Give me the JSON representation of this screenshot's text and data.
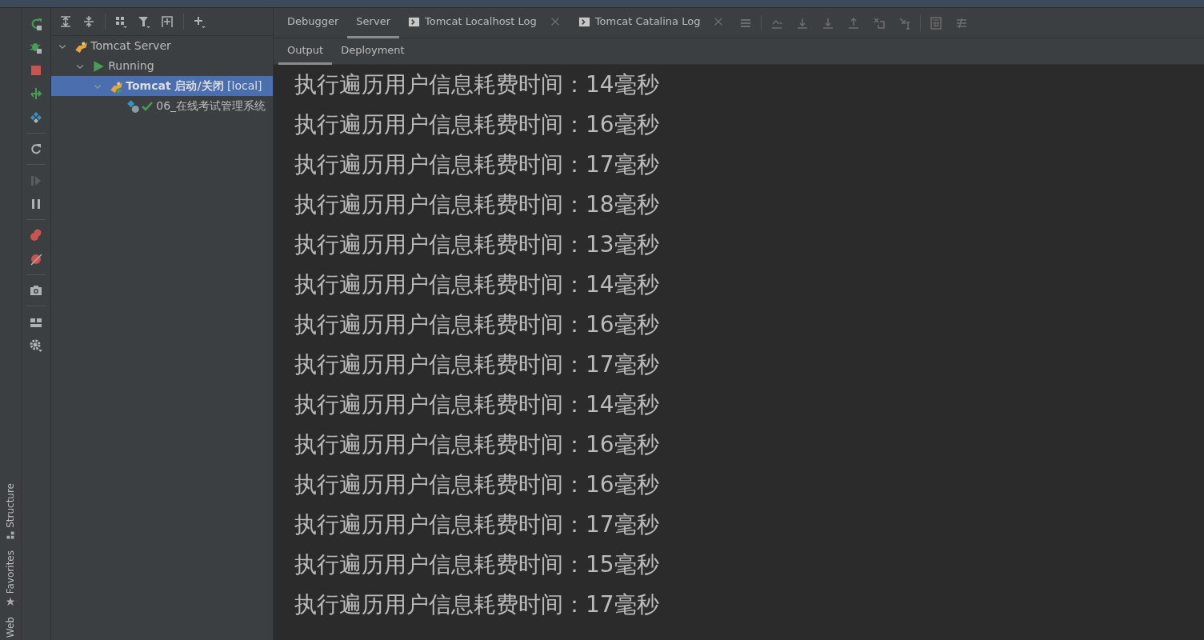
{
  "side_tool_windows": [
    {
      "label": "Structure",
      "kind": "structure"
    },
    {
      "label": "Favorites",
      "kind": "favorites"
    },
    {
      "label": "Web",
      "kind": "web"
    }
  ],
  "tree": [
    {
      "label": "Tomcat Server",
      "kind": "server",
      "expanded": true,
      "selected": false,
      "children": [
        {
          "label": "Running",
          "kind": "running",
          "expanded": true,
          "selected": false,
          "children": [
            {
              "label": "**Tomcat 启动/关闭** [local]",
              "kind": "instance",
              "expanded": true,
              "selected": true,
              "children": [
                {
                  "label": "06_在线考试管理系统",
                  "kind": "artifact",
                  "selected": false
                }
              ]
            }
          ]
        }
      ]
    }
  ],
  "tabs": [
    {
      "label": "Debugger",
      "closable": false,
      "selected": false
    },
    {
      "label": "Server",
      "closable": false,
      "selected": true
    },
    {
      "label": "Tomcat Localhost Log",
      "closable": true,
      "selected": false
    },
    {
      "label": "Tomcat Catalina Log",
      "closable": true,
      "selected": false
    }
  ],
  "sub_tabs": [
    {
      "label": "Output",
      "selected": true
    },
    {
      "label": "Deployment",
      "selected": false
    }
  ],
  "output_lines": [
    "执行遍历用户信息耗费时间：14毫秒",
    "执行遍历用户信息耗费时间：16毫秒",
    "执行遍历用户信息耗费时间：17毫秒",
    "执行遍历用户信息耗费时间：18毫秒",
    "执行遍历用户信息耗费时间：13毫秒",
    "执行遍历用户信息耗费时间：14毫秒",
    "执行遍历用户信息耗费时间：16毫秒",
    "执行遍历用户信息耗费时间：17毫秒",
    "执行遍历用户信息耗费时间：14毫秒",
    "执行遍历用户信息耗费时间：16毫秒",
    "执行遍历用户信息耗费时间：16毫秒",
    "执行遍历用户信息耗费时间：17毫秒",
    "执行遍历用户信息耗费时间：15毫秒",
    "执行遍历用户信息耗费时间：17毫秒"
  ]
}
